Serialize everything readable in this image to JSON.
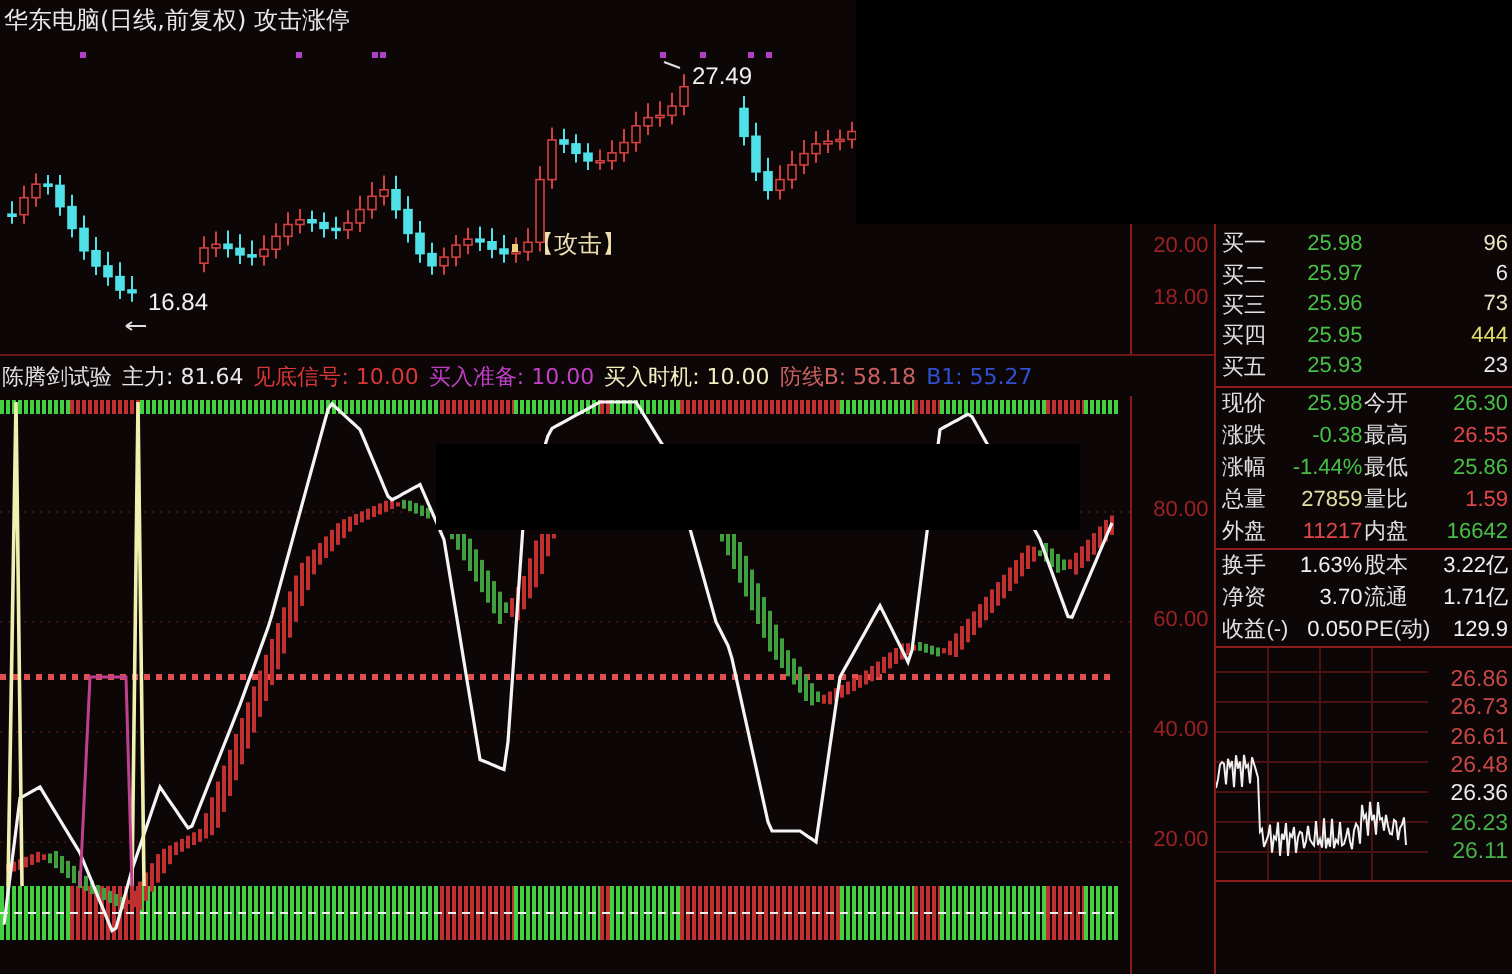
{
  "title": "华东电脑(日线,前复权) 攻击涨停",
  "price_chart": {
    "high_label": "27.49",
    "low_label": "16.84",
    "signal_label": "【攻击】",
    "axis": [
      "20.00",
      "18.00"
    ]
  },
  "indicator": {
    "legend": [
      {
        "text": "陈腾剑试验",
        "color": "#e0e0e0"
      },
      {
        "text": "主力: 81.64",
        "color": "#e8e8e8"
      },
      {
        "text": "见底信号: 10.00",
        "color": "#d83838"
      },
      {
        "text": "买入准备: 10.00",
        "color": "#c040c8"
      },
      {
        "text": "买入时机: 10.00",
        "color": "#f0f0c0"
      },
      {
        "text": "防线B: 58.18",
        "color": "#c86060"
      },
      {
        "text": "B1: 55.27",
        "color": "#3050d0"
      }
    ],
    "axis": [
      "80.00",
      "60.00",
      "40.00",
      "20.00"
    ]
  },
  "order_book": [
    {
      "label": "买一",
      "price": "25.98",
      "volume": "96",
      "color": "#e8e8c8"
    },
    {
      "label": "买二",
      "price": "25.97",
      "volume": "6",
      "color": "#e8e8e8"
    },
    {
      "label": "买三",
      "price": "25.96",
      "volume": "73",
      "color": "#e8e8c8"
    },
    {
      "label": "买四",
      "price": "25.95",
      "volume": "444",
      "color": "#e0e070"
    },
    {
      "label": "买五",
      "price": "25.93",
      "volume": "23",
      "color": "#e8e8e8"
    }
  ],
  "stats": [
    {
      "rows": [
        {
          "cells": [
            {
              "text": "现价",
              "color": "#e0e0e0"
            },
            {
              "text": "25.98",
              "color": "#48c048"
            },
            {
              "text": "今开",
              "color": "#e0e0e0"
            },
            {
              "text": "26.30",
              "color": "#48c048"
            }
          ]
        },
        {
          "cells": [
            {
              "text": "涨跌",
              "color": "#e0e0e0"
            },
            {
              "text": "-0.38",
              "color": "#48c048"
            },
            {
              "text": "最高",
              "color": "#e0e0e0"
            },
            {
              "text": "26.55",
              "color": "#e04848"
            }
          ]
        },
        {
          "cells": [
            {
              "text": "涨幅",
              "color": "#e0e0e0"
            },
            {
              "text": "-1.44%",
              "color": "#48c048"
            },
            {
              "text": "最低",
              "color": "#e0e0e0"
            },
            {
              "text": "25.86",
              "color": "#48c048"
            }
          ]
        },
        {
          "cells": [
            {
              "text": "总量",
              "color": "#e0e0e0"
            },
            {
              "text": "27859",
              "color": "#e0e0a0"
            },
            {
              "text": "量比",
              "color": "#e0e0e0"
            },
            {
              "text": "1.59",
              "color": "#e04848"
            }
          ]
        },
        {
          "cells": [
            {
              "text": "外盘",
              "color": "#e0e0e0"
            },
            {
              "text": "11217",
              "color": "#e04848"
            },
            {
              "text": "内盘",
              "color": "#e0e0e0"
            },
            {
              "text": "16642",
              "color": "#48c048"
            }
          ]
        }
      ]
    },
    {
      "rows": [
        {
          "cells": [
            {
              "text": "换手",
              "color": "#e0e0e0"
            },
            {
              "text": "1.63%",
              "color": "#f0f0f0"
            },
            {
              "text": "股本",
              "color": "#e0e0e0"
            },
            {
              "text": "3.22亿",
              "color": "#f0f0f0"
            }
          ]
        },
        {
          "cells": [
            {
              "text": "净资",
              "color": "#e0e0e0"
            },
            {
              "text": "3.70",
              "color": "#f0f0f0"
            },
            {
              "text": "流通",
              "color": "#e0e0e0"
            },
            {
              "text": "1.71亿",
              "color": "#f0f0f0"
            }
          ]
        },
        {
          "cells": [
            {
              "text": "收益(-)",
              "color": "#e0e0e0"
            },
            {
              "text": "0.050",
              "color": "#f0f0f0"
            },
            {
              "text": "PE(动)",
              "color": "#e0e0e0"
            },
            {
              "text": "129.9",
              "color": "#f0f0f0"
            }
          ]
        }
      ]
    }
  ],
  "minute_chart": {
    "price_labels": [
      {
        "text": "26.86",
        "color": "#c84848"
      },
      {
        "text": "26.73",
        "color": "#c84848"
      },
      {
        "text": "26.61",
        "color": "#c84848"
      },
      {
        "text": "26.48",
        "color": "#c84848"
      },
      {
        "text": "26.36",
        "color": "#e8e8e8"
      },
      {
        "text": "26.23",
        "color": "#48b048"
      },
      {
        "text": "26.11",
        "color": "#48b048"
      }
    ]
  }
}
